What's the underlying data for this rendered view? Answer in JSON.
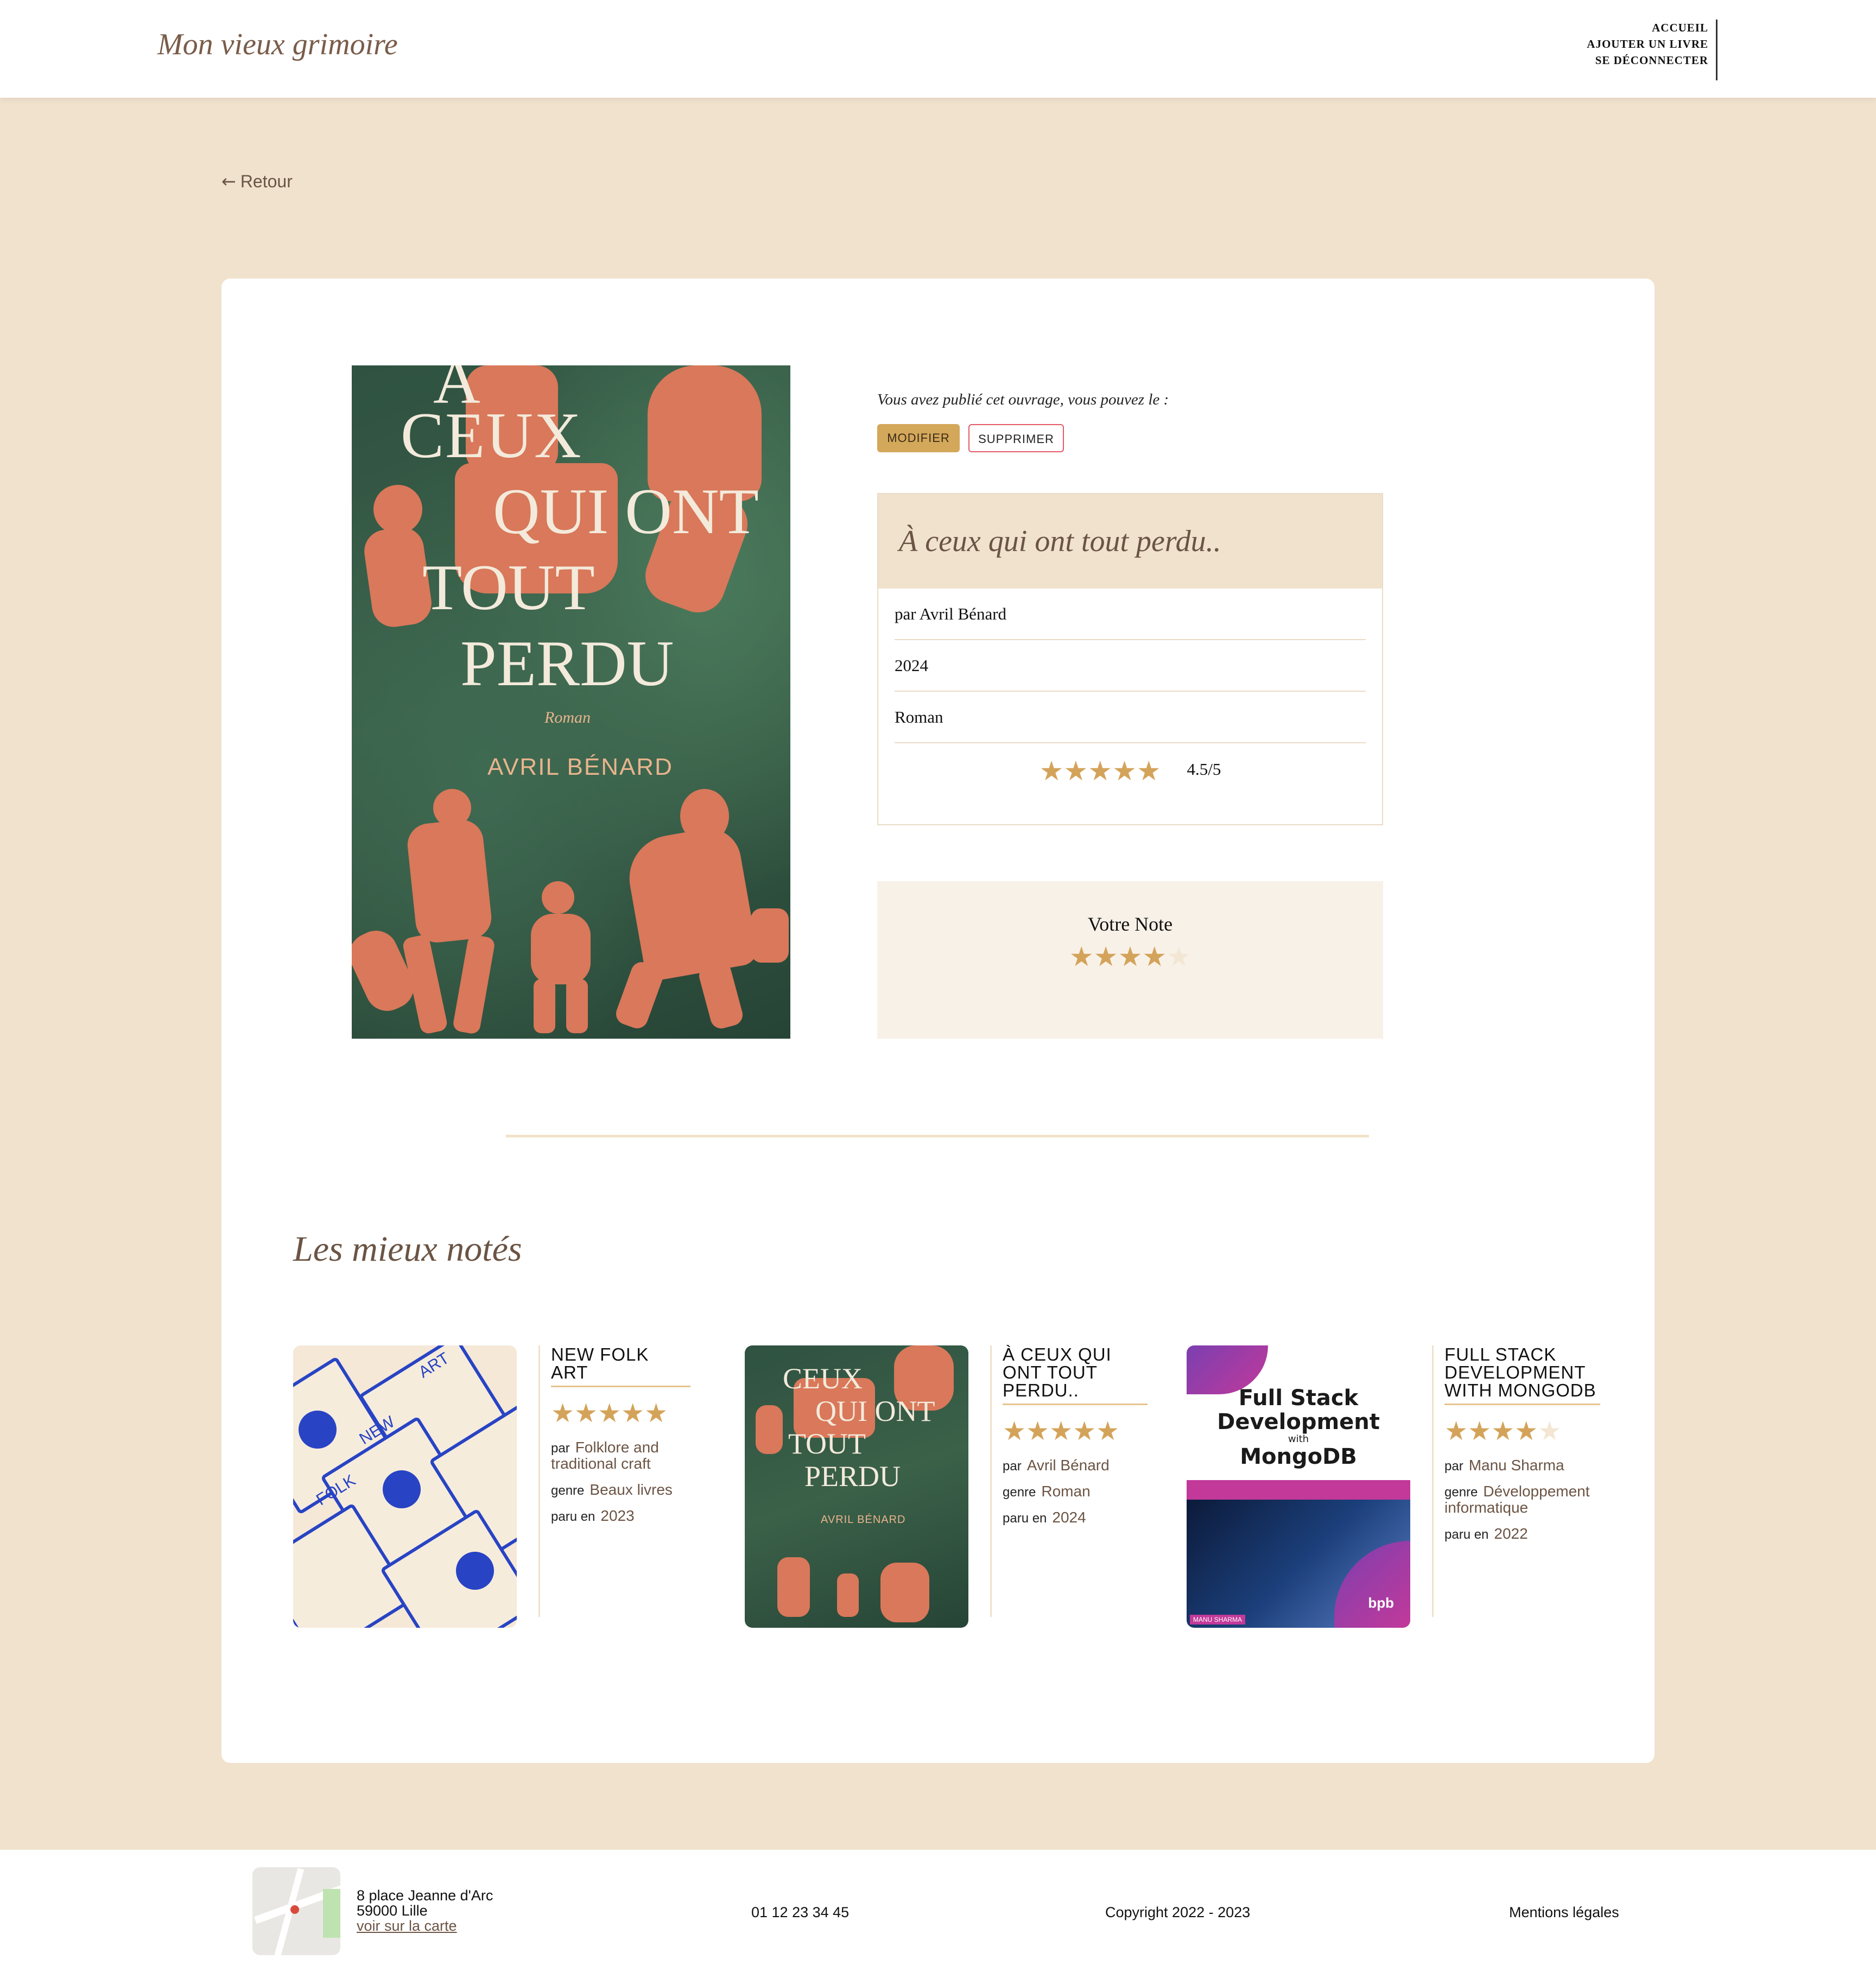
{
  "header": {
    "brand": "Mon vieux grimoire",
    "nav": [
      "ACCUEIL",
      "AJOUTER UN LIVRE",
      "SE DÉCONNECTER"
    ]
  },
  "back_label": "Retour",
  "book": {
    "cover": {
      "title_lines": [
        "À",
        "CEUX",
        "QUI ONT",
        "TOUT",
        "PERDU"
      ],
      "genre": "Roman",
      "author": "AVRIL BÉNARD"
    },
    "published_notice": "Vous avez publié cet ouvrage, vous pouvez le :",
    "edit_label": "MODIFIER",
    "delete_label": "SUPPRIMER",
    "title": "À ceux qui ont tout perdu..",
    "author_line": "par Avril Bénard",
    "year": "2024",
    "genre": "Roman",
    "rating_text": "4.5/5",
    "rating": 4.5,
    "vote_title": "Votre Note",
    "user_rating": 4
  },
  "best_rated": {
    "title": "Les mieux notés",
    "labels": {
      "by": "par",
      "genre": "genre",
      "year": "paru en"
    },
    "books": [
      {
        "title": "NEW FOLK ART",
        "rating": 5,
        "author": "Folklore and traditional craft",
        "genre": "Beaux livres",
        "year": "2023"
      },
      {
        "title": "À CEUX QUI ONT TOUT PERDU..",
        "rating": 5,
        "author": "Avril Bénard",
        "genre": "Roman",
        "year": "2024"
      },
      {
        "title": "FULL STACK DEVELOPMENT WITH MONGODB",
        "rating": 4,
        "author": "Manu Sharma",
        "genre": "Développement informatique",
        "year": "2022"
      }
    ],
    "mongo_cover": {
      "title_a": "Full Stack",
      "title_b": "Development",
      "with": "with",
      "title_c": "MongoDB",
      "author": "MANU SHARMA",
      "publisher": "bpb"
    },
    "folk_cover": {
      "word_a": "NEW",
      "word_b": "FOLK",
      "word_c": "ART"
    }
  },
  "footer": {
    "address_line1": "8 place Jeanne d'Arc",
    "address_line2": "59000 Lille",
    "map_link": "voir sur la carte",
    "phone": "01 12 23 34 45",
    "copyright": "Copyright 2022 - 2023",
    "legal": "Mentions légales"
  },
  "colors": {
    "page_bg": "#f0e2cd",
    "accent": "#d4a85a",
    "brown": "#6b5444",
    "danger": "#e35a66",
    "star_off": "#f3e6d3"
  }
}
